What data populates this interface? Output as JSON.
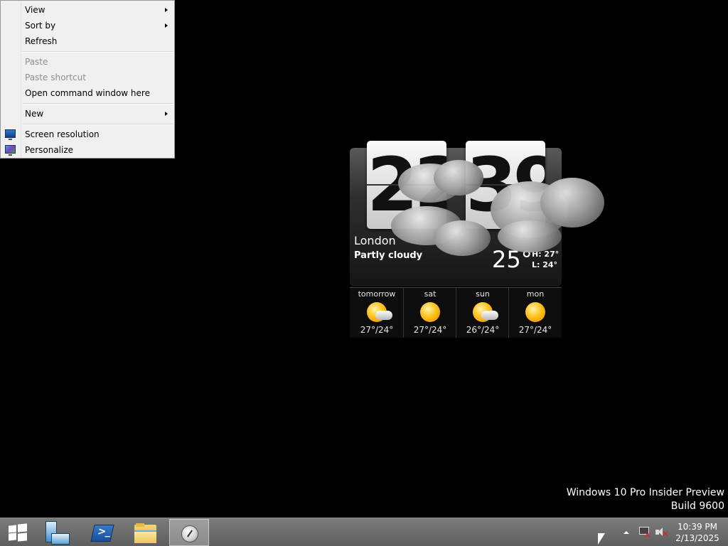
{
  "context_menu": {
    "items": [
      {
        "label": "View",
        "submenu": true
      },
      {
        "label": "Sort by",
        "submenu": true
      },
      {
        "label": "Refresh"
      },
      {
        "label": "Paste",
        "disabled": true
      },
      {
        "label": "Paste shortcut",
        "disabled": true
      },
      {
        "label": "Open command window here"
      },
      {
        "label": "New",
        "submenu": true
      },
      {
        "label": "Screen resolution",
        "icon": "screen-resolution-icon"
      },
      {
        "label": "Personalize",
        "icon": "personalize-icon"
      }
    ]
  },
  "weather": {
    "hours": "22",
    "minutes": "39",
    "city": "London",
    "condition": "Partly cloudy",
    "current_temp": "25°",
    "high": "H: 27°",
    "low": "L:  24°",
    "forecast": [
      {
        "day": "tomorrow",
        "temps": "27°/24°",
        "icon": "partly-sunny-icon"
      },
      {
        "day": "sat",
        "temps": "27°/24°",
        "icon": "sunny-icon"
      },
      {
        "day": "sun",
        "temps": "26°/24°",
        "icon": "partly-sunny-icon"
      },
      {
        "day": "mon",
        "temps": "27°/24°",
        "icon": "sunny-icon"
      }
    ]
  },
  "watermark": {
    "line1": "Windows 10 Pro Insider Preview",
    "line2": "Build 9600"
  },
  "taskbar": {
    "pinned": [
      "server-manager-icon",
      "powershell-icon",
      "file-explorer-icon",
      "clock-app-icon"
    ],
    "active": "clock-app-icon",
    "clock_time": "10:39 PM",
    "clock_date": "2/13/2025"
  },
  "colors": {
    "desktop_bg": "#000000",
    "taskbar_bg": "#6e6e6e",
    "menu_bg": "#f0f0f0",
    "error_red": "#e02020"
  }
}
